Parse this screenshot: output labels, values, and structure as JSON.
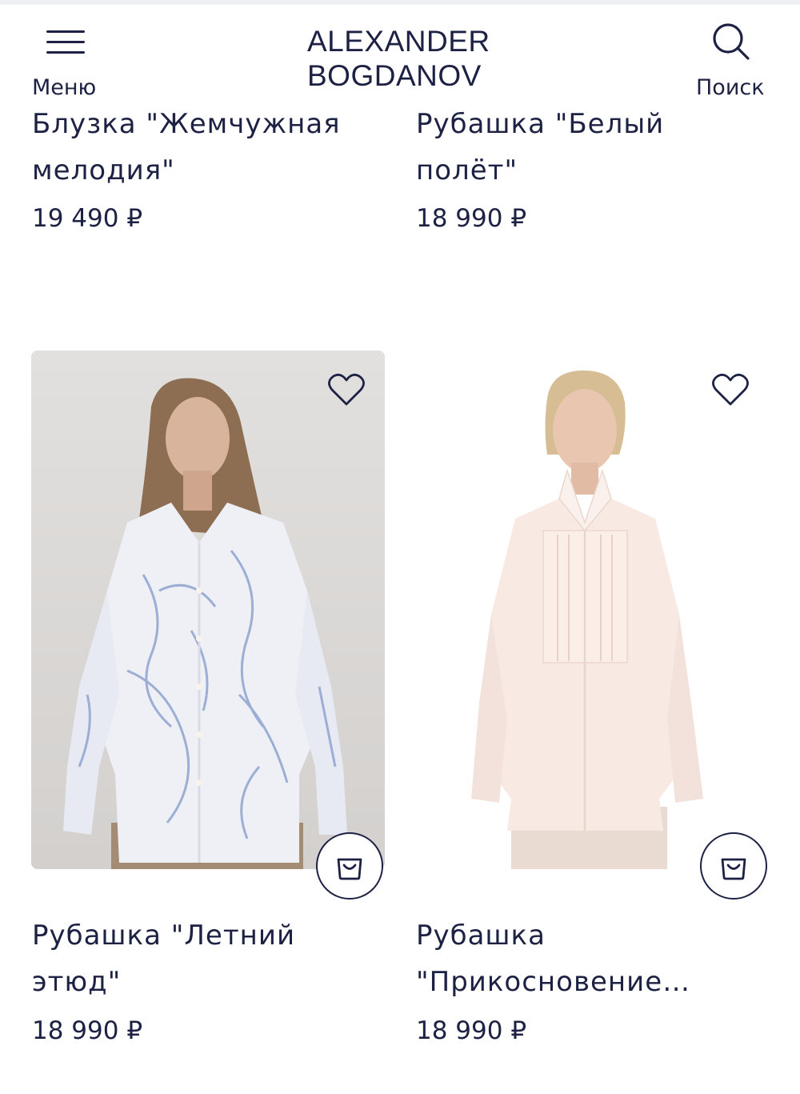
{
  "header": {
    "menu_label": "Меню",
    "logo_line1": "ALEXANDER",
    "logo_line2": "BOGDANOV",
    "search_label": "Поиск"
  },
  "products": [
    {
      "title_line1": "Блузка \"Жемчужная",
      "title_line2": "мелодия\"",
      "price": "19 490 ₽"
    },
    {
      "title_line1": "Рубашка \"Белый",
      "title_line2": "полёт\"",
      "price": "18 990 ₽"
    },
    {
      "title_line1": "Рубашка \"Летний",
      "title_line2": "этюд\"",
      "price": "18 990 ₽"
    },
    {
      "title_line1": "Рубашка",
      "title_line2": "\"Прикосновение…",
      "price": "18 990 ₽"
    }
  ],
  "colors": {
    "text": "#1d2244",
    "card_bg_gray": "#dddbd9",
    "card_bg_white": "#ffffff"
  },
  "icons": [
    "menu-icon",
    "search-icon",
    "heart-icon",
    "shopping-bag-icon"
  ]
}
